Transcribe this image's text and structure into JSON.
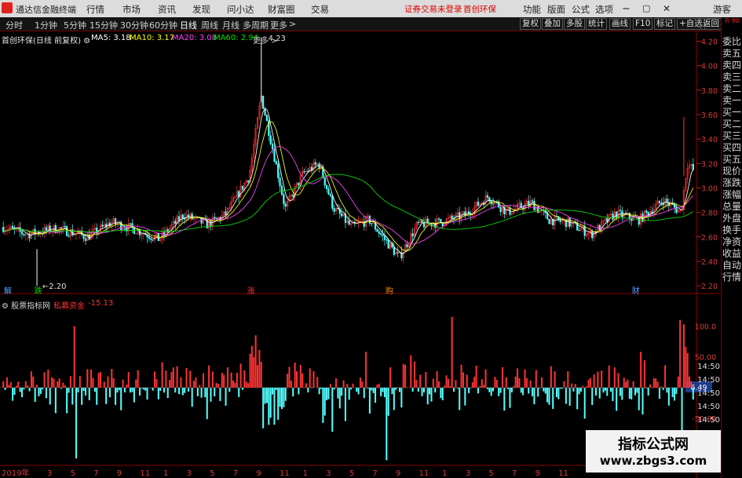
{
  "menubar": {
    "app_title": "通达信金融终端",
    "items": [
      "行情",
      "市场",
      "资讯",
      "发现",
      "问小达",
      "财富圈",
      "交易"
    ],
    "warning": "证券交易未登录",
    "stock_name": "首创环保",
    "right_items": [
      "功能",
      "版面",
      "公式",
      "选项"
    ],
    "guest": "游客",
    "window_controls": [
      "minimize-icon",
      "restore-icon",
      "close-icon"
    ]
  },
  "toolbar": {
    "periods": [
      "分时",
      "1分钟",
      "5分钟",
      "15分钟",
      "30分钟",
      "60分钟",
      "日线",
      "周线",
      "月线",
      "多周期",
      "更多"
    ],
    "active_period": "日线",
    "right_items": [
      "复权",
      "叠加",
      "多股",
      "统计",
      "画线",
      "F10",
      "标记",
      "+自选",
      "返回"
    ]
  },
  "legend": {
    "stock": "首创环保(日线 前复权)",
    "ma5": "MA5: 3.18",
    "ma10": "MA10: 3.17",
    "ma20": "MA20: 3.08",
    "ma60": "MA60: 2.94",
    "colors": {
      "ma5": "#ffffff",
      "ma10": "#ffff00",
      "ma20": "#ff44ff",
      "ma60": "#00e000",
      "candle_up": "#ff3232",
      "candle_down": "#54ffff"
    }
  },
  "price_axis": {
    "ticks": [
      4.2,
      4.0,
      3.8,
      3.6,
      3.4,
      3.2,
      3.0,
      2.8,
      2.6,
      2.4,
      2.2
    ],
    "labels": [
      "4.20",
      "4.00",
      "3.80",
      "3.60",
      "3.40",
      "3.20",
      "3.00",
      "2.80",
      "2.60",
      "2.40",
      "2.20"
    ]
  },
  "annotations": {
    "high_label": "4.23",
    "low_label": "2.20"
  },
  "event_markers": [
    {
      "text": "解",
      "color": "#4fa0ff",
      "x_pos": 0.0
    },
    {
      "text": "跌",
      "color": "#00d800",
      "x_pos": 0.045
    },
    {
      "text": "涨",
      "color": "#ff3232",
      "x_pos": 0.36
    },
    {
      "text": "购",
      "color": "#ff8c00",
      "x_pos": 0.565
    },
    {
      "text": "财",
      "color": "#4fa0ff",
      "x_pos": 0.93
    }
  ],
  "indicator": {
    "source": "股票指标网",
    "name": "私募资金",
    "value": "-15.13",
    "axis_labels": [
      "100.0",
      "50.00",
      "-50.00"
    ],
    "axis_values": [
      100,
      50,
      -50
    ],
    "current_tag": "6.49",
    "right_times": [
      "14:50",
      "14:50",
      "14:50",
      "14:50",
      "14:50",
      "14:50",
      "14:50",
      "14:50"
    ]
  },
  "right_panel": {
    "top": "R 90",
    "items": [
      "委比",
      "卖五",
      "卖四",
      "卖三",
      "卖二",
      "卖一",
      "买一",
      "买二",
      "买三",
      "买四",
      "买五",
      "现价",
      "涨跌",
      "涨幅",
      "总量",
      "外盘",
      "换手",
      "净资",
      "收益",
      "自动",
      "行情"
    ]
  },
  "x_axis": {
    "year_label": "2019年",
    "month_labels": [
      "3",
      "5",
      "7",
      "9",
      "11",
      "1",
      "3",
      "5",
      "7",
      "9",
      "11",
      "1",
      "3",
      "5",
      "7",
      "9",
      "11",
      "1",
      "3",
      "5",
      "7",
      "9",
      "11"
    ]
  },
  "chart_data": {
    "type": "candlestick",
    "ylim": [
      2.13,
      4.28
    ],
    "series": [
      {
        "name": "MA5"
      },
      {
        "name": "MA10"
      },
      {
        "name": "MA20"
      },
      {
        "name": "MA60"
      }
    ],
    "indicator_series": {
      "name": "私募资金",
      "ylim": [
        -120,
        130
      ]
    }
  },
  "watermark": {
    "line1": "指标公式网",
    "line2": "www.zbgs3.com"
  }
}
